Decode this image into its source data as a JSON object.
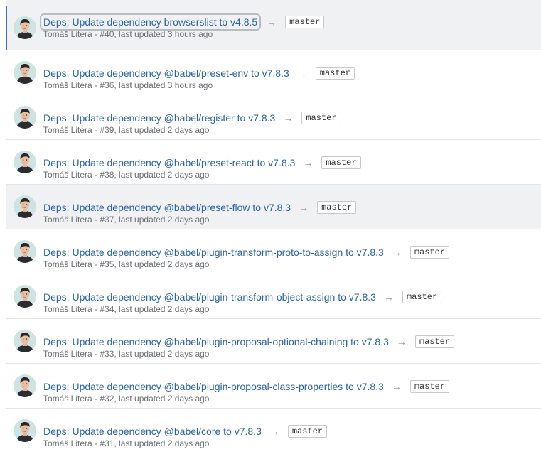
{
  "pull_requests": [
    {
      "title": "Deps: Update dependency browserslist to v4.8.5",
      "branch": "master",
      "meta": "Tomáš Litera - #40, last updated 3 hours ago",
      "selected": true
    },
    {
      "title": "Deps: Update dependency @babel/preset-env to v7.8.3",
      "branch": "master",
      "meta": "Tomáš Litera - #36, last updated 3 hours ago"
    },
    {
      "title": "Deps: Update dependency @babel/register to v7.8.3",
      "branch": "master",
      "meta": "Tomáš Litera - #39, last updated 2 days ago"
    },
    {
      "title": "Deps: Update dependency @babel/preset-react to v7.8.3",
      "branch": "master",
      "meta": "Tomáš Litera - #38, last updated 2 days ago"
    },
    {
      "title": "Deps: Update dependency @babel/preset-flow to v7.8.3",
      "branch": "master",
      "meta": "Tomáš Litera - #37, last updated 2 days ago",
      "hover": true
    },
    {
      "title": "Deps: Update dependency @babel/plugin-transform-proto-to-assign to v7.8.3",
      "branch": "master",
      "meta": "Tomáš Litera - #35, last updated 2 days ago"
    },
    {
      "title": "Deps: Update dependency @babel/plugin-transform-object-assign to v7.8.3",
      "branch": "master",
      "meta": "Tomáš Litera - #34, last updated 2 days ago"
    },
    {
      "title": "Deps: Update dependency @babel/plugin-proposal-optional-chaining to v7.8.3",
      "branch": "master",
      "meta": "Tomáš Litera - #33, last updated 2 days ago"
    },
    {
      "title": "Deps: Update dependency @babel/plugin-proposal-class-properties to v7.8.3",
      "branch": "master",
      "meta": "Tomáš Litera - #32, last updated 2 days ago"
    },
    {
      "title": "Deps: Update dependency @babel/core to v7.8.3",
      "branch": "master",
      "meta": "Tomáš Litera - #31, last updated 2 days ago"
    }
  ],
  "arrow_glyph": "→",
  "colors": {
    "link": "#2b63a8",
    "selected_bg": "#f0f1f3",
    "selected_bar": "#3b73c9",
    "meta_text": "#6b6f74"
  },
  "icons": {
    "avatar": "user-avatar",
    "arrow": "arrow-right-icon"
  }
}
